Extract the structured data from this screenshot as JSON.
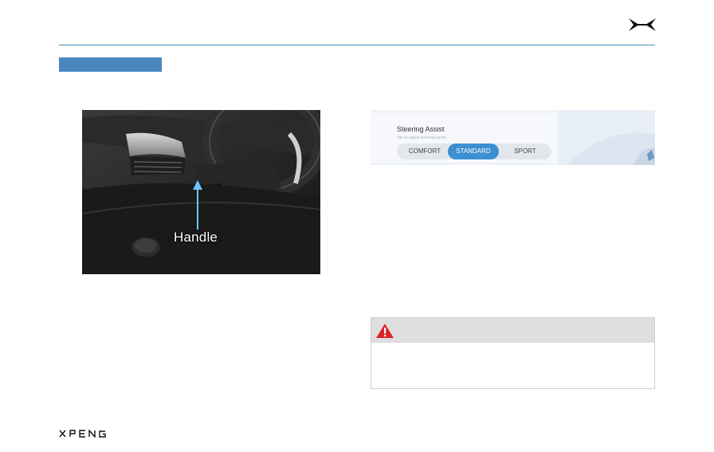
{
  "figure": {
    "callout_label": "Handle"
  },
  "steering_ui": {
    "title": "Steering Assist",
    "subtitle": "Tap to adjust steering assist",
    "options": [
      "COMFORT",
      "STANDARD",
      "SPORT"
    ],
    "selected": "STANDARD"
  },
  "colors": {
    "accent": "#4a87c0",
    "rule": "#4a8fb5",
    "selected_option": "#3c8fd0",
    "warning_red": "#d9232a",
    "warning_bar": "#dedede"
  },
  "icons": {
    "brand": "xpeng-x-logo",
    "warning": "warning-triangle-icon",
    "footer": "xpeng-wordmark"
  }
}
